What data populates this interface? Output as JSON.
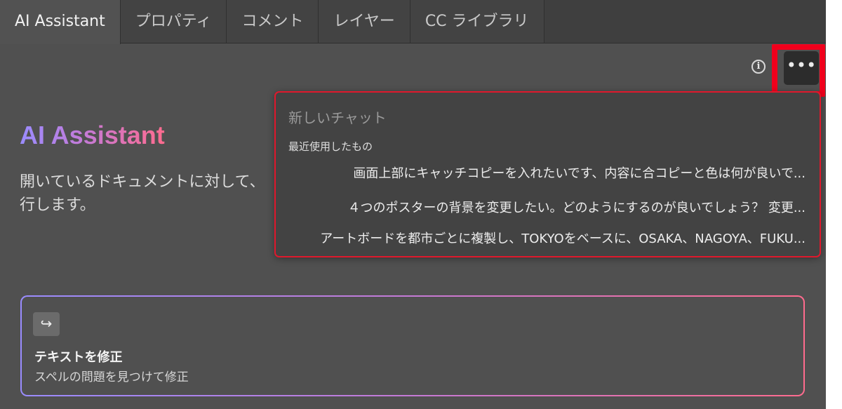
{
  "tabs": [
    {
      "label": "AI Assistant",
      "active": true
    },
    {
      "label": "プロパティ",
      "active": false
    },
    {
      "label": "コメント",
      "active": false
    },
    {
      "label": "レイヤー",
      "active": false
    },
    {
      "label": "CC ライブラリ",
      "active": false
    }
  ],
  "toolbar": {
    "info_glyph": "i",
    "more_glyph": "•••",
    "info_icon": "info-icon",
    "more_icon": "more-options-icon"
  },
  "hero": {
    "title": "AI Assistant",
    "description_line1": "開いているドキュメントに対して、",
    "description_line2": "行します。"
  },
  "dropdown": {
    "new_chat": "新しいチャット",
    "recent_label": "最近使用したもの",
    "recent_items": [
      "画面上部にキャッチコピーを入れたいです、内容に合コピーと色は何が良いで...",
      "４つのポスターの背景を変更したい。どのようにするのが良いでしょう？ 変更...",
      "アートボードを都市ごとに複製し、TOKYOをベースに、OSAKA、NAGOYA、FUKU..."
    ]
  },
  "action_card": {
    "icon": "redirect-arrow-icon",
    "icon_glyph": "↪",
    "title": "テキストを修正",
    "description": "スペルの問題を見つけて修正"
  },
  "colors": {
    "highlight_red": "#f0001c",
    "dropdown_border": "#e0182c",
    "gradient_start": "#9a8cff",
    "gradient_end": "#ff6b8e"
  }
}
